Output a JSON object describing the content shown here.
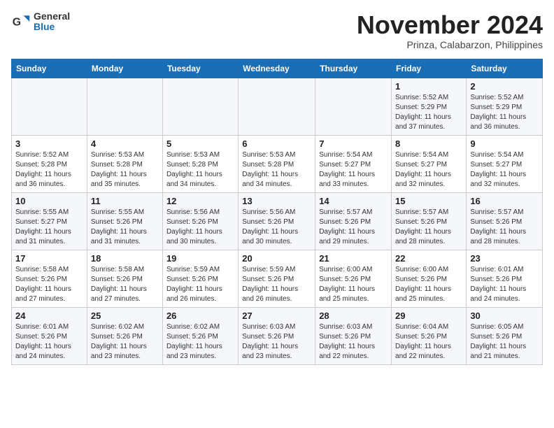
{
  "header": {
    "logo_line1": "General",
    "logo_line2": "Blue",
    "month": "November 2024",
    "location": "Prinza, Calabarzon, Philippines"
  },
  "weekdays": [
    "Sunday",
    "Monday",
    "Tuesday",
    "Wednesday",
    "Thursday",
    "Friday",
    "Saturday"
  ],
  "weeks": [
    [
      {
        "day": "",
        "info": ""
      },
      {
        "day": "",
        "info": ""
      },
      {
        "day": "",
        "info": ""
      },
      {
        "day": "",
        "info": ""
      },
      {
        "day": "",
        "info": ""
      },
      {
        "day": "1",
        "info": "Sunrise: 5:52 AM\nSunset: 5:29 PM\nDaylight: 11 hours\nand 37 minutes."
      },
      {
        "day": "2",
        "info": "Sunrise: 5:52 AM\nSunset: 5:29 PM\nDaylight: 11 hours\nand 36 minutes."
      }
    ],
    [
      {
        "day": "3",
        "info": "Sunrise: 5:52 AM\nSunset: 5:28 PM\nDaylight: 11 hours\nand 36 minutes."
      },
      {
        "day": "4",
        "info": "Sunrise: 5:53 AM\nSunset: 5:28 PM\nDaylight: 11 hours\nand 35 minutes."
      },
      {
        "day": "5",
        "info": "Sunrise: 5:53 AM\nSunset: 5:28 PM\nDaylight: 11 hours\nand 34 minutes."
      },
      {
        "day": "6",
        "info": "Sunrise: 5:53 AM\nSunset: 5:28 PM\nDaylight: 11 hours\nand 34 minutes."
      },
      {
        "day": "7",
        "info": "Sunrise: 5:54 AM\nSunset: 5:27 PM\nDaylight: 11 hours\nand 33 minutes."
      },
      {
        "day": "8",
        "info": "Sunrise: 5:54 AM\nSunset: 5:27 PM\nDaylight: 11 hours\nand 32 minutes."
      },
      {
        "day": "9",
        "info": "Sunrise: 5:54 AM\nSunset: 5:27 PM\nDaylight: 11 hours\nand 32 minutes."
      }
    ],
    [
      {
        "day": "10",
        "info": "Sunrise: 5:55 AM\nSunset: 5:27 PM\nDaylight: 11 hours\nand 31 minutes."
      },
      {
        "day": "11",
        "info": "Sunrise: 5:55 AM\nSunset: 5:26 PM\nDaylight: 11 hours\nand 31 minutes."
      },
      {
        "day": "12",
        "info": "Sunrise: 5:56 AM\nSunset: 5:26 PM\nDaylight: 11 hours\nand 30 minutes."
      },
      {
        "day": "13",
        "info": "Sunrise: 5:56 AM\nSunset: 5:26 PM\nDaylight: 11 hours\nand 30 minutes."
      },
      {
        "day": "14",
        "info": "Sunrise: 5:57 AM\nSunset: 5:26 PM\nDaylight: 11 hours\nand 29 minutes."
      },
      {
        "day": "15",
        "info": "Sunrise: 5:57 AM\nSunset: 5:26 PM\nDaylight: 11 hours\nand 28 minutes."
      },
      {
        "day": "16",
        "info": "Sunrise: 5:57 AM\nSunset: 5:26 PM\nDaylight: 11 hours\nand 28 minutes."
      }
    ],
    [
      {
        "day": "17",
        "info": "Sunrise: 5:58 AM\nSunset: 5:26 PM\nDaylight: 11 hours\nand 27 minutes."
      },
      {
        "day": "18",
        "info": "Sunrise: 5:58 AM\nSunset: 5:26 PM\nDaylight: 11 hours\nand 27 minutes."
      },
      {
        "day": "19",
        "info": "Sunrise: 5:59 AM\nSunset: 5:26 PM\nDaylight: 11 hours\nand 26 minutes."
      },
      {
        "day": "20",
        "info": "Sunrise: 5:59 AM\nSunset: 5:26 PM\nDaylight: 11 hours\nand 26 minutes."
      },
      {
        "day": "21",
        "info": "Sunrise: 6:00 AM\nSunset: 5:26 PM\nDaylight: 11 hours\nand 25 minutes."
      },
      {
        "day": "22",
        "info": "Sunrise: 6:00 AM\nSunset: 5:26 PM\nDaylight: 11 hours\nand 25 minutes."
      },
      {
        "day": "23",
        "info": "Sunrise: 6:01 AM\nSunset: 5:26 PM\nDaylight: 11 hours\nand 24 minutes."
      }
    ],
    [
      {
        "day": "24",
        "info": "Sunrise: 6:01 AM\nSunset: 5:26 PM\nDaylight: 11 hours\nand 24 minutes."
      },
      {
        "day": "25",
        "info": "Sunrise: 6:02 AM\nSunset: 5:26 PM\nDaylight: 11 hours\nand 23 minutes."
      },
      {
        "day": "26",
        "info": "Sunrise: 6:02 AM\nSunset: 5:26 PM\nDaylight: 11 hours\nand 23 minutes."
      },
      {
        "day": "27",
        "info": "Sunrise: 6:03 AM\nSunset: 5:26 PM\nDaylight: 11 hours\nand 23 minutes."
      },
      {
        "day": "28",
        "info": "Sunrise: 6:03 AM\nSunset: 5:26 PM\nDaylight: 11 hours\nand 22 minutes."
      },
      {
        "day": "29",
        "info": "Sunrise: 6:04 AM\nSunset: 5:26 PM\nDaylight: 11 hours\nand 22 minutes."
      },
      {
        "day": "30",
        "info": "Sunrise: 6:05 AM\nSunset: 5:26 PM\nDaylight: 11 hours\nand 21 minutes."
      }
    ]
  ]
}
